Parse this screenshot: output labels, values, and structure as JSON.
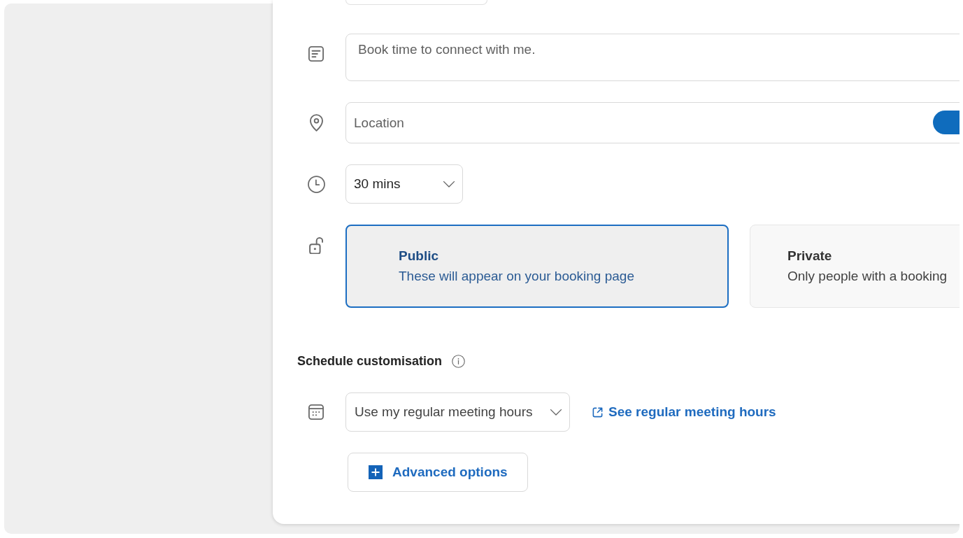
{
  "form": {
    "description": {
      "value": "Book time to connect with me."
    },
    "location": {
      "placeholder": "Location",
      "toggle_on": true
    },
    "duration": {
      "value": "30 mins"
    },
    "visibility": [
      {
        "title": "Public",
        "description": "These will appear on your booking page",
        "selected": true
      },
      {
        "title": "Private",
        "description": "Only people with a booking",
        "selected": false
      }
    ]
  },
  "schedule_customisation": {
    "title": "Schedule customisation",
    "availability": {
      "value": "Use my regular meeting hours"
    },
    "link": "See regular meeting hours",
    "button": "Advanced options"
  }
}
